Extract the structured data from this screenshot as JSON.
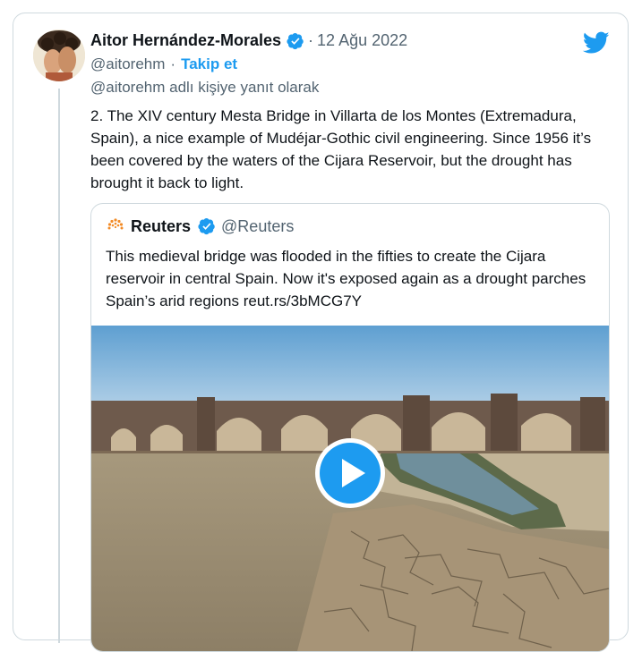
{
  "author": {
    "name": "Aitor Hernández-Morales",
    "handle": "@aitorehm",
    "separator": "·",
    "date": "12 Ağu 2022",
    "follow_label": "Takip et"
  },
  "reply_to": "@aitorehm adlı kişiye yanıt olarak",
  "tweet": {
    "text": "2. The XIV century Mesta Bridge in Villarta de los Montes (Extremadura, Spain), a nice example of Mudéjar-Gothic civil engineering. Since 1956 it’s been covered by the waters of the Cijara Reservoir, but the drought has brought it back to light."
  },
  "quoted": {
    "name": "Reuters",
    "handle": "@Reuters",
    "text": "This medieval bridge was flooded in the fifties to create the Cijara reservoir in central Spain. Now it's exposed again as a drought parches Spain’s arid regions reut.rs/3bMCG7Y"
  },
  "colors": {
    "accent": "#1d9bf0",
    "text": "#0f1419",
    "muted": "#536471",
    "border": "#cfd9de"
  },
  "icons": {
    "twitter": "twitter-bird-icon",
    "verified": "verified-badge-icon",
    "play": "play-icon"
  }
}
